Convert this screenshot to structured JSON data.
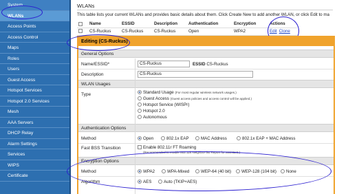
{
  "sidebar": {
    "items": [
      {
        "label": "System"
      },
      {
        "label": "WLANs"
      },
      {
        "label": "Access Points"
      },
      {
        "label": "Access Control"
      },
      {
        "label": "Maps"
      },
      {
        "label": "Roles"
      },
      {
        "label": "Users"
      },
      {
        "label": "Guest Access"
      },
      {
        "label": "Hotspot Services"
      },
      {
        "label": "Hotspot 2.0 Services"
      },
      {
        "label": "Mesh"
      },
      {
        "label": "AAA Servers"
      },
      {
        "label": "DHCP Relay"
      },
      {
        "label": "Alarm Settings"
      },
      {
        "label": "Services"
      },
      {
        "label": "WIPS"
      },
      {
        "label": "Certificate"
      }
    ]
  },
  "page": {
    "title": "WLANs",
    "intro": "This table lists your current WLANs and provides basic details about them. Click Create New to add another WLAN, or click Edit to ma"
  },
  "wlan_table": {
    "headers": [
      "",
      "Name",
      "ESSID",
      "Description",
      "Authentication",
      "Encryption",
      "Actions"
    ],
    "rows": [
      {
        "name": "CS-Ruckus",
        "essid": "CS-Ruckus",
        "description": "CS-Ruckus",
        "authentication": "Open",
        "encryption": "WPA2",
        "edit": "Edit",
        "clone": "Clone"
      }
    ]
  },
  "edit_panel": {
    "title": "Editing (CS-Ruckus)",
    "general_options": {
      "header": "General Options",
      "name_label": "Name/ESSID*",
      "name_value": "CS-Ruckus",
      "essid_label": "ESSID",
      "essid_value": "CS-Ruckus",
      "description_label": "Description",
      "description_value": "CS-Ruckus"
    },
    "wlan_usages": {
      "header": "WLAN Usages",
      "type_label": "Type",
      "options": [
        {
          "label": "Standard Usage",
          "note": "(For most regular wireless network usages.)",
          "selected": true
        },
        {
          "label": "Guest Access",
          "note": "(Guest access policies and access control will be applied.)",
          "selected": false
        },
        {
          "label": "Hotspot Service (WISPr)",
          "note": "",
          "selected": false
        },
        {
          "label": "Hotspot 2.0",
          "note": "",
          "selected": false
        },
        {
          "label": "Autonomous",
          "note": "",
          "selected": false
        }
      ]
    },
    "authentication_options": {
      "header": "Authentication Options",
      "method_label": "Method",
      "methods": [
        {
          "label": "Open",
          "selected": true
        },
        {
          "label": "802.1x EAP",
          "selected": false
        },
        {
          "label": "MAC Address",
          "selected": false
        },
        {
          "label": "802.1x EAP + MAC Address",
          "selected": false
        }
      ],
      "fast_bss_label": "Fast BSS Transition",
      "fast_bss_checkbox": "Enable 802.11r FT Roaming",
      "fast_bss_note": "(Recommended to enable 802.11k Neighbor-list Report for assistant.)"
    },
    "encryption_options": {
      "header": "Encryption Options",
      "method_label": "Method",
      "methods": [
        {
          "label": "WPA2",
          "selected": true
        },
        {
          "label": "WPA-Mixed",
          "selected": false
        },
        {
          "label": "WEP-64 (40 bit)",
          "selected": false
        },
        {
          "label": "WEP-128 (104 bit)",
          "selected": false
        },
        {
          "label": "None",
          "selected": false
        }
      ],
      "algorithm_label": "Algorithm",
      "algorithms": [
        {
          "label": "AES",
          "selected": true
        },
        {
          "label": "Auto (TKIP+AES)",
          "selected": false
        }
      ]
    }
  },
  "colors": {
    "sidebar_bg": "#2d6fb0",
    "panel_accent": "#f0a32c",
    "annotation_ink": "#2b1fd0",
    "link": "#1a44c8"
  }
}
